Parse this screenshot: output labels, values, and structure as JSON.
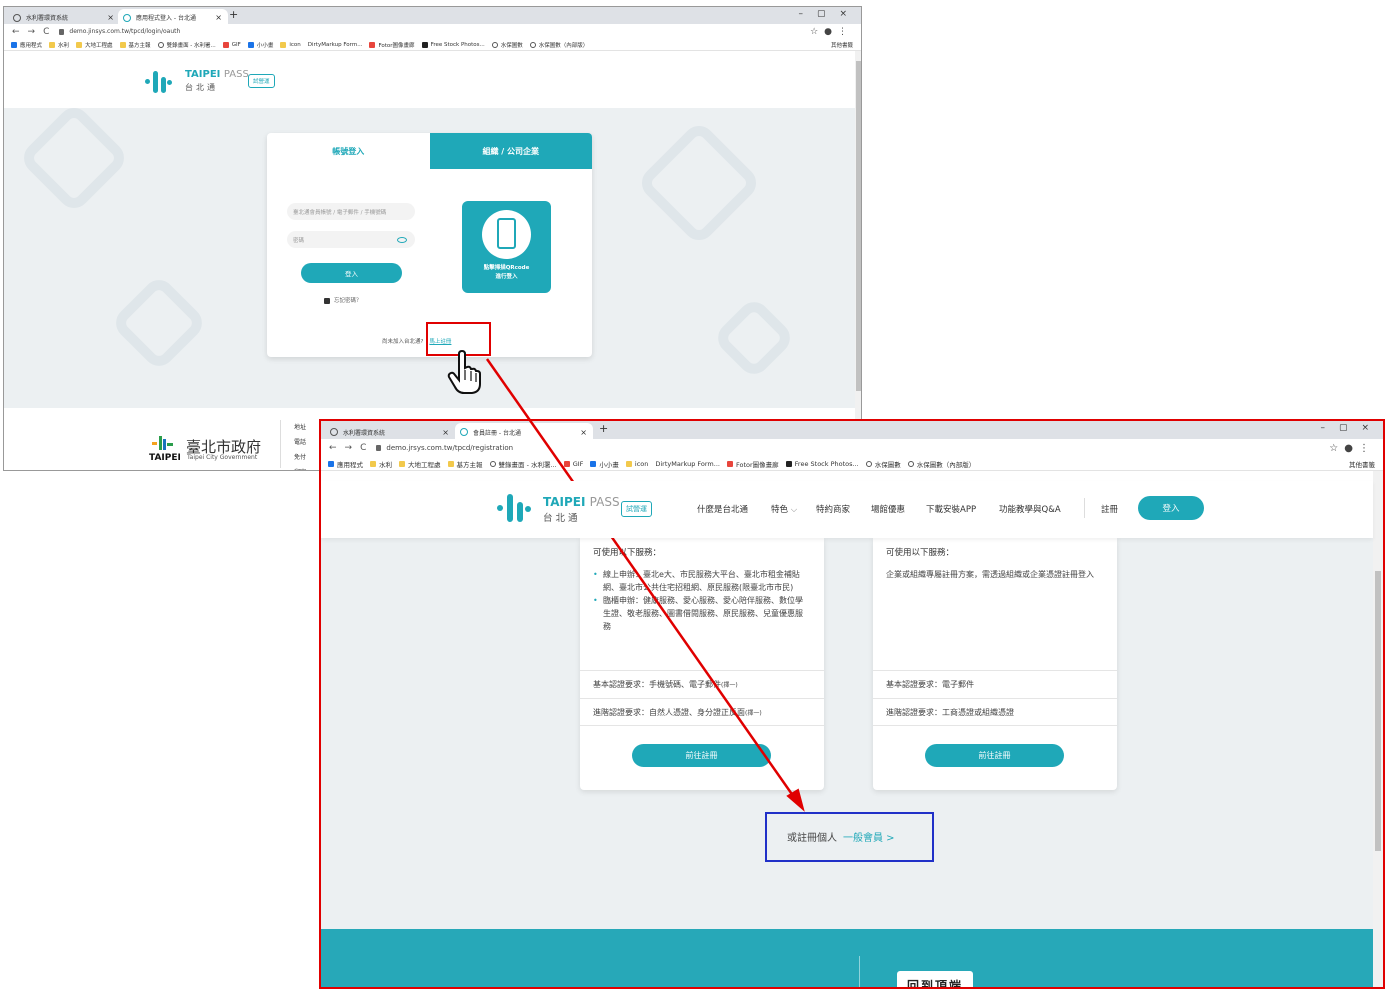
{
  "window1": {
    "tabs": [
      {
        "label": "水利署環資系統",
        "active": false
      },
      {
        "label": "應用程式登入 - 台北通",
        "active": true
      }
    ],
    "url": "demo.jinsys.com.tw/tpcd/login/oauth",
    "bookmarks": [
      "應用程式",
      "水利",
      "大地工程處",
      "基方主報",
      "雙錄畫面 - 水利署...",
      "GIF",
      "小小畫",
      "icon",
      "DirtyMarkup Form...",
      "Fotor圖像畫廊",
      "Free Stock Photos...",
      "水保圖數",
      "水保圖數（內部版）"
    ],
    "other_bookmarks": "其他書籤",
    "logo": {
      "en_main": "TAIPEI",
      "en_sub": "PASS",
      "zh": "台北通",
      "badge": "試營運"
    },
    "login_tabs": {
      "account": "帳號登入",
      "org": "組織 / 公司企業"
    },
    "account_placeholder": "臺北通會員帳號 / 電子郵件 / 手機號碼",
    "password_placeholder": "密碼",
    "login_button": "登入",
    "forgot_password": "忘記密碼？",
    "qr_text_line1": "點擊掃描QRcode",
    "qr_text_line2": "進行登入",
    "no_account_text": "尚未加入台北通?",
    "register_link": "馬上註冊",
    "footer": {
      "gov_name_zh": "臺北市政府",
      "gov_name_en": "Taipei City Government",
      "gov_mark": "TAIPEI",
      "info": [
        "地址",
        "電話",
        "免付",
        "郵寄"
      ]
    }
  },
  "window2": {
    "tabs": [
      {
        "label": "水利署環資系統",
        "active": false
      },
      {
        "label": "會員註冊 - 台北通",
        "active": true
      }
    ],
    "url": "demo.jrsys.com.tw/tpcd/registration",
    "bookmarks": [
      "應用程式",
      "水利",
      "大地工程處",
      "基方主報",
      "雙錄畫面 - 水利署...",
      "GIF",
      "小小畫",
      "icon",
      "DirtyMarkup Form...",
      "Fotor圖像畫廊",
      "Free Stock Photos...",
      "水保圖數",
      "水保圖數（內部版）"
    ],
    "other_bookmarks": "其他書籤",
    "logo": {
      "en_main": "TAIPEI",
      "en_sub": "PASS",
      "zh": "台北通",
      "badge": "試營運"
    },
    "nav": [
      "什麼是台北通",
      "特色",
      "特約商家",
      "場館優惠",
      "下載安裝APP",
      "功能教學與Q&A",
      "註冊"
    ],
    "login_button": "登入",
    "card_personal": {
      "heading": "可使用以下服務：",
      "items": [
        "線上申辦：臺北e大、市民服務大平台、臺北市租金補貼網、臺北市公共住宅招租網、原民服務(限臺北市市民)",
        "臨櫃申辦：健康服務、愛心服務、愛心陪伴服務、數位學生證、敬老服務、圖書借閱服務、原民服務、兒童優惠服務"
      ],
      "basic_req": "基本認證要求：手機號碼、電子郵件",
      "basic_note": "(擇一)",
      "adv_req": "進階認證要求：自然人憑證、身分證正反面",
      "adv_note": "(擇一)",
      "button": "前往註冊"
    },
    "card_org": {
      "heading": "可使用以下服務：",
      "text": "企業或組織專屬註冊方案，需透過組織或企業憑證註冊登入",
      "basic_req": "基本認證要求：電子郵件",
      "adv_req": "進階認證要求：工商憑證或組織憑證",
      "button": "前往註冊"
    },
    "personal_prompt": "或註冊個人",
    "personal_link": "一般會員 >",
    "band_box": "回到頂端"
  },
  "colors": {
    "accent": "#1fa8b8",
    "highlight_red": "#e00000",
    "highlight_blue": "#2030c8"
  }
}
